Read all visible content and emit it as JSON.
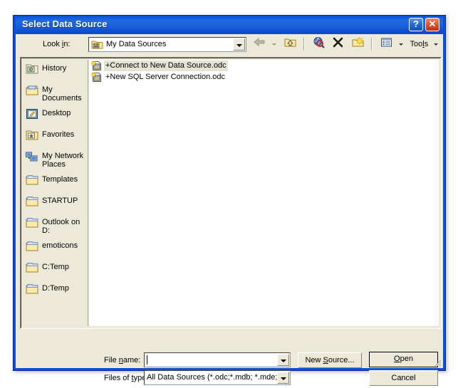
{
  "window": {
    "title": "Select Data Source",
    "help_button": "?",
    "close_button": "✕"
  },
  "lookin": {
    "label_pre": "Look ",
    "label_accel": "i",
    "label_post": "n:",
    "value": "My Data Sources",
    "icon": "folder-datasources-icon"
  },
  "toolbar": {
    "items": [
      {
        "name": "back-button",
        "icon": "back-arrow-icon",
        "enabled": false
      },
      {
        "name": "back-dropdown",
        "icon": "chevron-down-icon",
        "enabled": false
      },
      {
        "name": "up-one-level-button",
        "icon": "folder-up-icon",
        "enabled": true
      },
      {
        "name": "search-web-button",
        "icon": "search-globe-icon",
        "enabled": true
      },
      {
        "name": "delete-button",
        "icon": "delete-x-icon",
        "enabled": true
      },
      {
        "name": "new-folder-button",
        "icon": "new-folder-icon",
        "enabled": true
      },
      {
        "name": "views-button",
        "icon": "views-list-icon",
        "enabled": true
      },
      {
        "name": "views-dropdown",
        "icon": "chevron-down-icon",
        "enabled": true
      }
    ],
    "tools_pre": "Too",
    "tools_accel": "l",
    "tools_post": "s"
  },
  "places": {
    "items": [
      {
        "label": "History",
        "icon": "history-folder-icon"
      },
      {
        "label": "My Documents",
        "icon": "my-documents-icon"
      },
      {
        "label": "Desktop",
        "icon": "desktop-icon"
      },
      {
        "label": "Favorites",
        "icon": "favorites-folder-icon"
      },
      {
        "label": "My Network Places",
        "icon": "network-places-icon"
      },
      {
        "label": "Templates",
        "icon": "folder-icon"
      },
      {
        "label": "STARTUP",
        "icon": "folder-icon"
      },
      {
        "label": "Outlook on D:",
        "icon": "folder-icon"
      },
      {
        "label": "emoticons",
        "icon": "folder-icon"
      },
      {
        "label": "C:Temp",
        "icon": "folder-icon"
      },
      {
        "label": "D:Temp",
        "icon": "folder-icon"
      }
    ]
  },
  "filelist": {
    "items": [
      {
        "label": "+Connect to New Data Source.odc",
        "icon": "odc-file-icon",
        "selected": true
      },
      {
        "label": "+New SQL Server Connection.odc",
        "icon": "odc-file-icon",
        "selected": false
      }
    ]
  },
  "filename": {
    "label_pre": "File ",
    "label_accel": "n",
    "label_post": "ame:",
    "value": "",
    "placeholder": ""
  },
  "filetype": {
    "label_pre": "Files of ",
    "label_accel": "t",
    "label_post": "ype:",
    "value": "All Data Sources (*.odc;*.mdb; *.mde;"
  },
  "buttons": {
    "new_source_pre": "New ",
    "new_source_accel": "S",
    "new_source_post": "ource...",
    "open_pre": "",
    "open_accel": "O",
    "open_post": "pen",
    "cancel": "Cancel"
  },
  "colors": {
    "title_blue": "#0a51d4",
    "face": "#ece9d8",
    "selection": "#e4e3d4",
    "close_red": "#c32c10"
  }
}
